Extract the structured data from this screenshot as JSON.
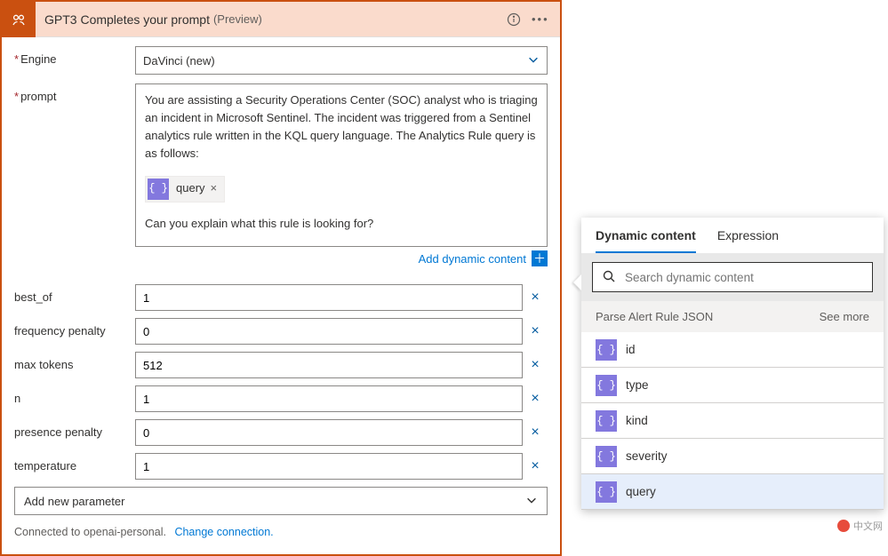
{
  "card": {
    "title": "GPT3 Completes your prompt",
    "preview": "(Preview)"
  },
  "engine": {
    "label": "Engine",
    "value": "DaVinci (new)"
  },
  "prompt": {
    "label": "prompt",
    "text1": "You are assisting a Security Operations Center (SOC) analyst who is triaging an incident in Microsoft Sentinel.  The incident was triggered from a Sentinel analytics rule written in the KQL query language.  The Analytics Rule query is as follows:",
    "pill": "query",
    "text2": "Can you explain what this rule is looking for?"
  },
  "addDynamic": "Add dynamic content",
  "params": [
    {
      "label": "best_of",
      "value": "1"
    },
    {
      "label": "frequency penalty",
      "value": "0"
    },
    {
      "label": "max tokens",
      "value": "512"
    },
    {
      "label": "n",
      "value": "1"
    },
    {
      "label": "presence penalty",
      "value": "0"
    },
    {
      "label": "temperature",
      "value": "1"
    }
  ],
  "addParam": "Add new parameter",
  "conn": {
    "text": "Connected to openai-personal.",
    "change": "Change connection."
  },
  "dynPanel": {
    "tabs": {
      "dynamic": "Dynamic content",
      "expr": "Expression"
    },
    "searchPlaceholder": "Search dynamic content",
    "groupTitle": "Parse Alert Rule JSON",
    "seeMore": "See more",
    "items": [
      "id",
      "type",
      "kind",
      "severity",
      "query"
    ],
    "selected": "query"
  },
  "watermark": "中文网"
}
